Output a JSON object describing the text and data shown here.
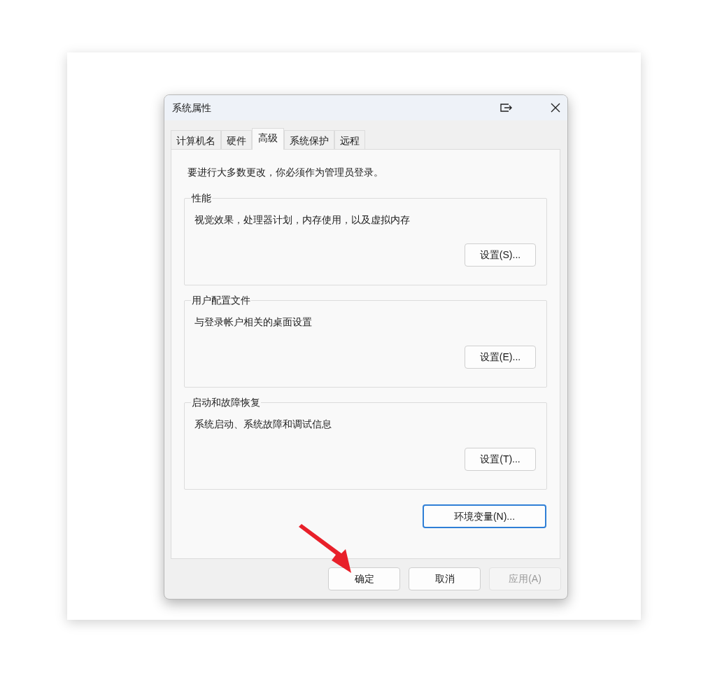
{
  "window": {
    "title": "系统属性"
  },
  "tabs": [
    {
      "label": "计算机名",
      "selected": false
    },
    {
      "label": "硬件",
      "selected": false
    },
    {
      "label": "高级",
      "selected": true
    },
    {
      "label": "系统保护",
      "selected": false
    },
    {
      "label": "远程",
      "selected": false
    }
  ],
  "notice": "要进行大多数更改，你必须作为管理员登录。",
  "groups": [
    {
      "title": "性能",
      "description": "视觉效果，处理器计划，内存使用，以及虚拟内存",
      "button": "设置(S)..."
    },
    {
      "title": "用户配置文件",
      "description": "与登录帐户相关的桌面设置",
      "button": "设置(E)..."
    },
    {
      "title": "启动和故障恢复",
      "description": "系统启动、系统故障和调试信息",
      "button": "设置(T)..."
    }
  ],
  "env_button": "环境变量(N)...",
  "buttons": [
    {
      "label": "确定",
      "disabled": false
    },
    {
      "label": "取消",
      "disabled": false
    },
    {
      "label": "应用(A)",
      "disabled": true
    }
  ]
}
